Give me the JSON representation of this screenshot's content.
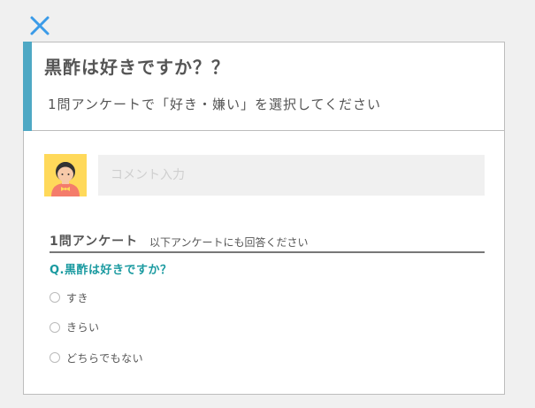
{
  "colors": {
    "accent": "#4ea8c4",
    "close": "#3b9be8",
    "question": "#1a9aa0",
    "avatar_bg": "#ffd95a"
  },
  "header": {
    "title": "黒酢は好きですか？？",
    "subtitle": "1問アンケートで「好き・嫌い」を選択してください"
  },
  "comment": {
    "placeholder": "コメント入力",
    "value": ""
  },
  "survey": {
    "title": "1問アンケート",
    "note": "以下アンケートにも回答ください",
    "question": "Q.黒酢は好きですか？",
    "options": [
      {
        "label": "すき"
      },
      {
        "label": "きらい"
      },
      {
        "label": "どちらでもない"
      }
    ]
  },
  "icons": {
    "close": "close-icon",
    "avatar": "user-avatar-icon"
  }
}
